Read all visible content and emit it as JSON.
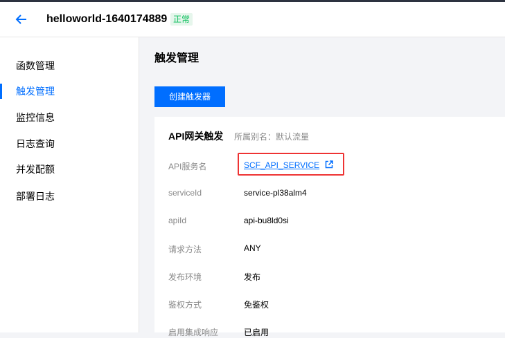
{
  "header": {
    "title": "helloworld-1640174889",
    "status": "正常"
  },
  "sidebar": {
    "items": [
      {
        "label": "函数管理",
        "active": false
      },
      {
        "label": "触发管理",
        "active": true
      },
      {
        "label": "监控信息",
        "active": false
      },
      {
        "label": "日志查询",
        "active": false
      },
      {
        "label": "并发配额",
        "active": false
      },
      {
        "label": "部署日志",
        "active": false
      }
    ]
  },
  "main": {
    "page_title": "触发管理",
    "create_button": "创建触发器",
    "card": {
      "title": "API网关触发",
      "subtitle": "所属别名：默认流量",
      "rows": [
        {
          "label": "API服务名",
          "value": "SCF_API_SERVICE"
        },
        {
          "label": "serviceId",
          "value": "service-pl38alm4"
        },
        {
          "label": "apiId",
          "value": "api-bu8ld0si"
        },
        {
          "label": "请求方法",
          "value": "ANY"
        },
        {
          "label": "发布环境",
          "value": "发布"
        },
        {
          "label": "鉴权方式",
          "value": "免鉴权"
        },
        {
          "label": "启用集成响应",
          "value": "已启用"
        }
      ]
    }
  },
  "colors": {
    "accent": "#006eff",
    "status_green": "#0abf5b",
    "highlight_red": "#e33"
  }
}
